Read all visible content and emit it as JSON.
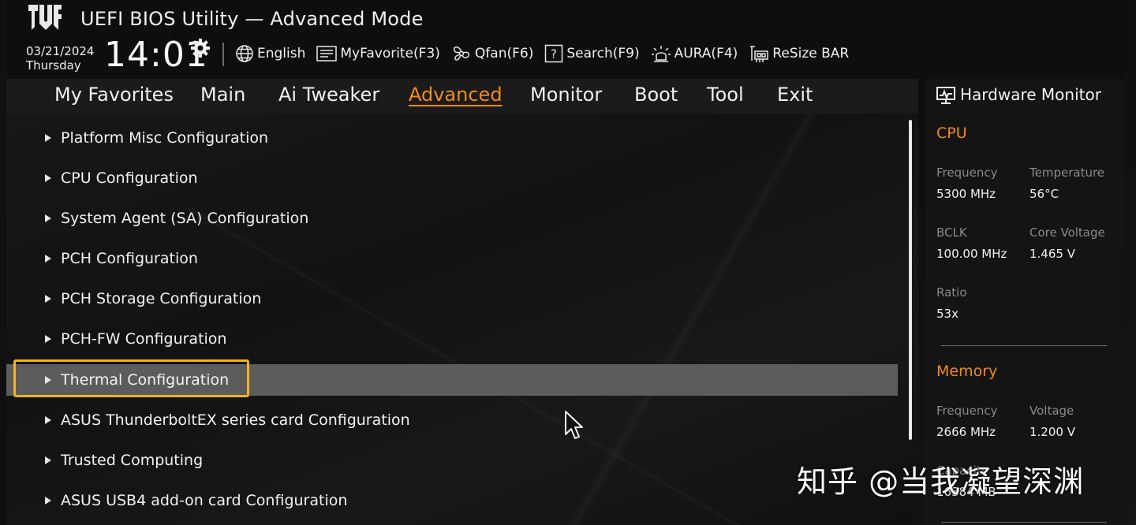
{
  "header": {
    "app_title": "UEFI BIOS Utility — Advanced Mode",
    "date": "03/21/2024",
    "day": "Thursday",
    "time": "14:01"
  },
  "toolbar": {
    "language": "English",
    "myfavorite": "MyFavorite(F3)",
    "qfan": "Qfan(F6)",
    "search": "Search(F9)",
    "aura": "AURA(F4)",
    "resize_bar": "ReSize BAR"
  },
  "tabs": [
    {
      "label": "My Favorites"
    },
    {
      "label": "Main"
    },
    {
      "label": "Ai Tweaker"
    },
    {
      "label": "Advanced",
      "active": true
    },
    {
      "label": "Monitor"
    },
    {
      "label": "Boot"
    },
    {
      "label": "Tool"
    },
    {
      "label": "Exit"
    }
  ],
  "menu": {
    "items": [
      {
        "label": "Platform Misc Configuration"
      },
      {
        "label": "CPU Configuration"
      },
      {
        "label": "System Agent (SA) Configuration"
      },
      {
        "label": "PCH Configuration"
      },
      {
        "label": "PCH Storage Configuration"
      },
      {
        "label": "PCH-FW Configuration"
      },
      {
        "label": "Thermal Configuration",
        "selected": true
      },
      {
        "label": "ASUS ThunderboltEX series card Configuration"
      },
      {
        "label": "Trusted Computing"
      },
      {
        "label": "ASUS USB4 add-on card Configuration"
      }
    ]
  },
  "hardware_monitor": {
    "title": "Hardware Monitor",
    "cpu": {
      "section": "CPU",
      "frequency_label": "Frequency",
      "frequency_value": "5300 MHz",
      "temperature_label": "Temperature",
      "temperature_value": "56°C",
      "bclk_label": "BCLK",
      "bclk_value": "100.00 MHz",
      "core_voltage_label": "Core Voltage",
      "core_voltage_value": "1.465 V",
      "ratio_label": "Ratio",
      "ratio_value": "53x"
    },
    "memory": {
      "section": "Memory",
      "frequency_label": "Frequency",
      "frequency_value": "2666 MHz",
      "voltage_label": "Voltage",
      "voltage_value": "1.200 V",
      "capacity_label": "Capacity",
      "capacity_value": "16384 MB"
    }
  },
  "watermark": "知乎 @当我凝望深渊",
  "colors": {
    "accent": "#f08c1e",
    "highlight_border": "#f2b31b",
    "selected_row": "#5c5c5c"
  },
  "icons": {
    "logo": "tuf-logo",
    "settings": "gear-icon",
    "language": "globe-icon",
    "favorite": "list-icon",
    "qfan": "fan-icon",
    "search": "question-box-icon",
    "aura": "aura-light-icon",
    "resize_bar": "resize-bar-icon",
    "monitor": "monitor-icon",
    "cursor": "mouse-pointer-icon"
  }
}
